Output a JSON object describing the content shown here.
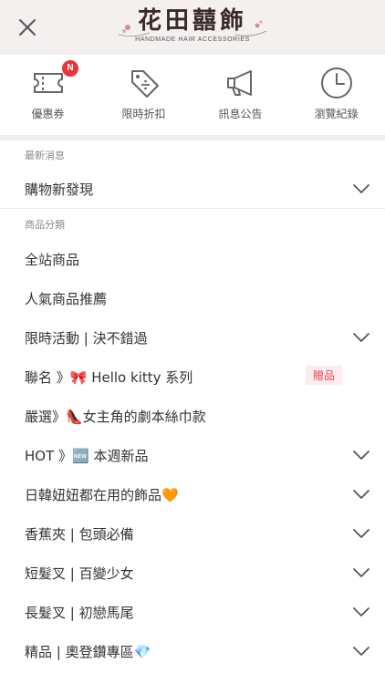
{
  "header": {
    "close_icon": "close-icon",
    "logo_title": "花田囍飾",
    "logo_subtitle": "HANDMADE HAIR ACCESSORIES"
  },
  "shortcuts": [
    {
      "label": "優惠券",
      "icon": "ticket-icon",
      "badge": "N"
    },
    {
      "label": "限時折扣",
      "icon": "discount-tag-icon"
    },
    {
      "label": "訊息公告",
      "icon": "megaphone-icon"
    },
    {
      "label": "瀏覽紀錄",
      "icon": "clock-icon"
    }
  ],
  "sections": {
    "news_title": "最新消息",
    "category_title": "商品分類"
  },
  "news_items": [
    {
      "label": "購物新發現",
      "expandable": true
    }
  ],
  "category_items": [
    {
      "label": "全站商品",
      "expandable": false
    },
    {
      "label": "人氣商品推薦",
      "expandable": false
    },
    {
      "label": "限時活動 | 決不錯過",
      "expandable": true
    },
    {
      "label": "聯名 》🎀 Hello kitty 系列",
      "expandable": false,
      "tag": "贈品"
    },
    {
      "label": "嚴選》👠女主角的劇本絲巾款",
      "expandable": false
    },
    {
      "label": "HOT 》🆕 本週新品",
      "expandable": true
    },
    {
      "label": "日韓妞妞都在用的飾品🧡",
      "expandable": true
    },
    {
      "label": "香蕉夾 | 包頭必備",
      "expandable": true
    },
    {
      "label": "短髮叉 | 百變少女",
      "expandable": true
    },
    {
      "label": "長髮叉 | 初戀馬尾",
      "expandable": true
    },
    {
      "label": "精品 | 奧登鑽專區💎",
      "expandable": true
    }
  ],
  "colors": {
    "header_bg": "#f4f0ef",
    "badge": "#e8343b",
    "gift_tag_bg": "#fdeced",
    "gift_tag_text": "#e24d55"
  }
}
